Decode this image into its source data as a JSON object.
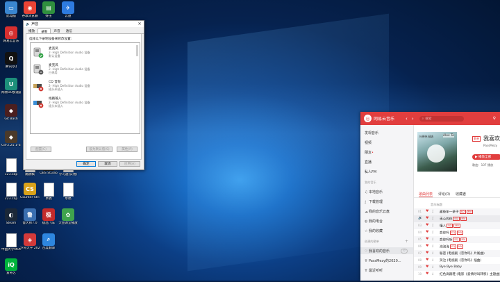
{
  "desktop": {
    "icons": [
      {
        "label": "此电脑",
        "color": "#3a86d0",
        "glyph": "▭",
        "icon": "computer-icon"
      },
      {
        "label": "谷歌浏览器",
        "color": "#e94335",
        "glyph": "◉",
        "icon": "chrome-icon"
      },
      {
        "label": "好压",
        "color": "#2f8f3e",
        "glyph": "▤",
        "icon": "archive-icon"
      },
      {
        "label": "云盘",
        "color": "#2e7be0",
        "glyph": "✈",
        "icon": "cloud-drive-icon"
      },
      {
        "label": "网易云音乐",
        "color": "#d62f2f",
        "glyph": "◎",
        "icon": "netease-music-icon"
      },
      {
        "label": "腾讯QQ",
        "color": "#111111",
        "glyph": "Q",
        "icon": "qq-icon"
      },
      {
        "label": "网易UU加速器",
        "color": "#1d8f7a",
        "glyph": "U",
        "icon": "uu-icon"
      },
      {
        "label": "Git Bash",
        "color": "#4b1f1f",
        "glyph": "◆",
        "icon": "git-bash-icon"
      },
      {
        "label": "Git-2.25.1-64-bit",
        "color": "#4b3a2a",
        "glyph": "◆",
        "icon": "git-installer-icon"
      },
      {
        "label": "123.cap",
        "color": "#ffffff",
        "glyph": "",
        "icon": "file-icon"
      },
      {
        "label": "跳跳棋",
        "color": "#ffffff",
        "glyph": "",
        "icon": "file-icon"
      },
      {
        "label": "OBS Studio",
        "color": "#222222",
        "glyph": "●",
        "icon": "obs-icon"
      },
      {
        "label": "学习通(实用)",
        "color": "#ffffff",
        "glyph": "",
        "icon": "file-icon"
      },
      {
        "label": "223.cap",
        "color": "#ffffff",
        "glyph": "",
        "icon": "file-icon"
      },
      {
        "label": "Counter-Strike Global Off...",
        "color": "#d9a21b",
        "glyph": "CS",
        "icon": "csgo-icon"
      },
      {
        "label": "草稿",
        "color": "#ffffff",
        "glyph": "",
        "icon": "file-icon"
      },
      {
        "label": "草稿",
        "color": "#ffffff",
        "glyph": "",
        "icon": "file-icon"
      },
      {
        "label": "Steam",
        "color": "#1b2838",
        "glyph": "◐",
        "icon": "steam-icon"
      },
      {
        "label": "鲁大师7.0",
        "color": "#3a6fb0",
        "glyph": "鲁",
        "icon": "ludashi-icon"
      },
      {
        "label": "极品飞车",
        "color": "#c32b2b",
        "glyph": "极",
        "icon": "racing-icon"
      },
      {
        "label": "大鱼课堂播放",
        "color": "#3fa34d",
        "glyph": "✿",
        "icon": "player-icon"
      },
      {
        "label": "中国大学MOOC",
        "color": "#ffffff",
        "glyph": "",
        "icon": "file-icon"
      },
      {
        "label": "汐哥大学 2020",
        "color": "#d33a3a",
        "glyph": "◈",
        "icon": "app-icon"
      },
      {
        "label": "百度翻译",
        "color": "#2e86de",
        "glyph": "⌕",
        "icon": "translate-icon"
      },
      {
        "label": "爱奇艺",
        "color": "#00b33c",
        "glyph": "iQ",
        "icon": "iqiyi-icon"
      }
    ]
  },
  "sound_dialog": {
    "title": "声音",
    "close": "✕",
    "tabs": [
      "播放",
      "录制",
      "声音",
      "通信"
    ],
    "active_tab": 1,
    "instruction": "选择以下录制设备来修改设置:",
    "devices": [
      {
        "name": "麦克风",
        "desc": "2- High Definition Audio 设备",
        "status": "默认设备",
        "default": true
      },
      {
        "name": "麦克风",
        "desc": "2- High Definition Audio 设备",
        "status": "已停用",
        "default": false
      },
      {
        "name": "CD 音频",
        "desc": "2- High Definition Audio 设备",
        "status": "插头未插入",
        "default": false
      },
      {
        "name": "线路输入",
        "desc": "2- High Definition Audio 设备",
        "status": "插头未插入",
        "default": false
      }
    ],
    "buttons": {
      "configure": "配置(C)",
      "set_default": "设为默认值(S)",
      "properties": "属性(P)",
      "ok": "确定",
      "cancel": "取消",
      "apply": "应用(A)"
    }
  },
  "music_app": {
    "brand": "网易云音乐",
    "accent": "#e13e3e",
    "search_placeholder": "搜索",
    "sidebar": {
      "discover": "发现音乐",
      "video": "视频",
      "friends": "朋友",
      "live": "直播",
      "private_fm": "私人FM",
      "my_music_header": "我的音乐",
      "local_music": "本地音乐",
      "downloads": "下载管理",
      "cloud": "我的音乐云盘",
      "radio": "我的电台",
      "collection": "我的收藏",
      "created_header": "创建的歌单",
      "add": "+",
      "playlist_liked": "我喜欢的音乐",
      "playlist_2": "PassMezy的2020...",
      "recent": "最近听听"
    },
    "playlist": {
      "badge": "歌单",
      "title": "我喜欢",
      "author": "PassMezy",
      "cover_text": "Alex To",
      "cover_sub": "杜德伟 精选",
      "play_all": "▶ 播放全部",
      "meta": "歌曲：107   播放"
    },
    "tabs": [
      "歌曲列表",
      "评论(0)",
      "收藏者"
    ],
    "column_header": "音乐标题",
    "songs": [
      {
        "num": "01",
        "name": "那些年一辈子",
        "tags": [
          "SQ",
          "MV"
        ]
      },
      {
        "num": "02",
        "name": "无心的伴",
        "tags": [
          "SQ",
          "MV"
        ],
        "playing": true
      },
      {
        "num": "03",
        "name": "懂人",
        "tags": [
          "SQ",
          "MV"
        ]
      },
      {
        "num": "04",
        "name": "恋你吗",
        "tags": [
          "SQ",
          "MV"
        ]
      },
      {
        "num": "05",
        "name": "恋你吗听",
        "tags": [
          "SQ",
          "MV"
        ]
      },
      {
        "num": "06",
        "name": "泡泡海",
        "tags": [
          "SQ",
          "MV"
        ]
      },
      {
        "num": "07",
        "name": "秘密 (电视剧《恋你吗》片尾曲)",
        "tags": []
      },
      {
        "num": "08",
        "name": "哭泣 (电视剧《恋你吗》插曲)",
        "tags": []
      },
      {
        "num": "09",
        "name": "Bye Bye Baby",
        "tags": []
      },
      {
        "num": "10",
        "name": "红色高跟鞋 (电影《爱情呼叫转移》主题曲)",
        "tags": []
      }
    ]
  }
}
